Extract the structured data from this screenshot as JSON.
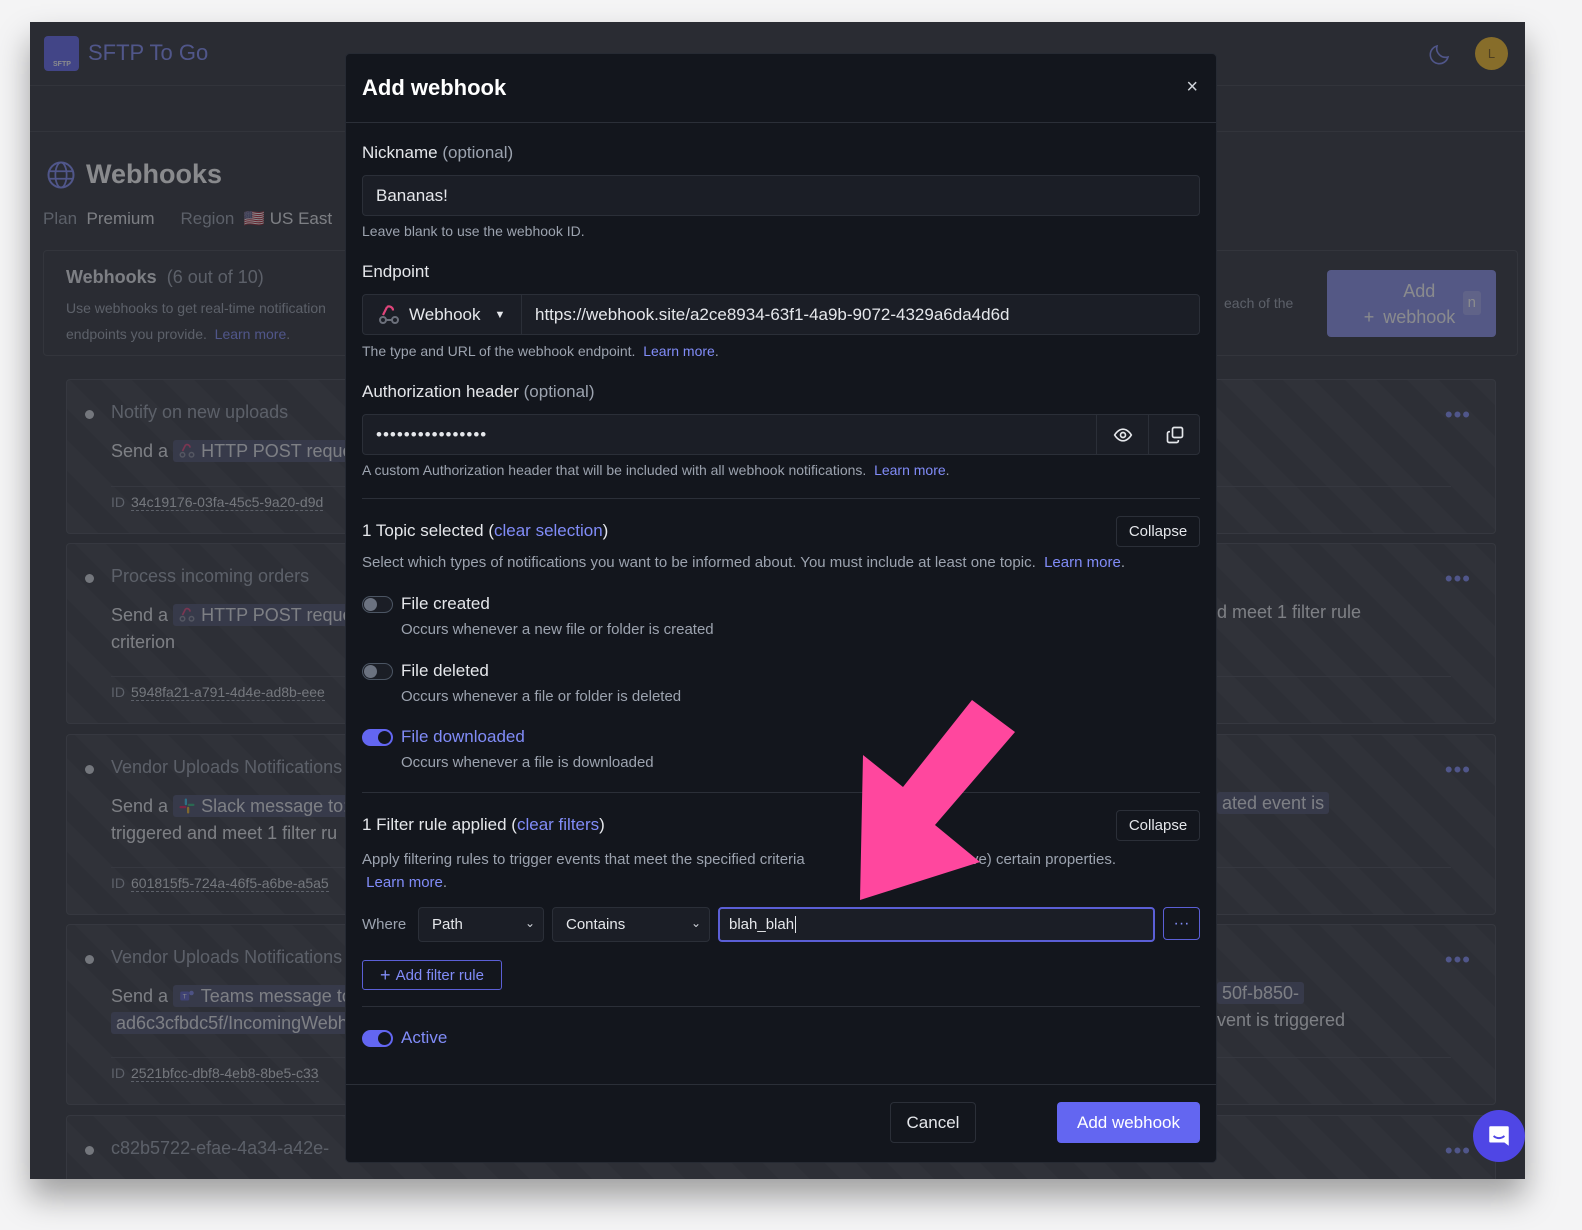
{
  "app": {
    "brand": "SFTP To Go",
    "logo_text": "SFTP",
    "avatar_initial": "L",
    "theme_icon": "moon-icon"
  },
  "page": {
    "title": "Webhooks",
    "plan_label": "Plan",
    "plan_value": "Premium",
    "region_label": "Region",
    "region_flag": "🇺🇸",
    "region_value": "US East",
    "panel": {
      "title": "Webhooks",
      "count": "(6 out of 10)",
      "description_start": "Use webhooks to get real-time notification",
      "description_end": "endpoints you provide.",
      "description_right": "each of the",
      "learn_more": "Learn more",
      "add_button": {
        "plus": "+",
        "label": "Add webhook",
        "shortcut": "n"
      }
    },
    "webhooks": [
      {
        "name": "Notify on new uploads",
        "send_prefix": "Send a",
        "chip": "HTTP POST reque",
        "chip_icon": "webhook-icon",
        "line2": "",
        "right_text": "",
        "id_label": "ID",
        "id": "34c19176-03fa-45c5-9a20-d9d"
      },
      {
        "name": "Process incoming orders",
        "send_prefix": "Send a",
        "chip": "HTTP POST reque",
        "chip_icon": "webhook-icon",
        "line2": "criterion",
        "right_text": "d meet 1 filter rule",
        "id_label": "ID",
        "id": "5948fa21-a791-4d4e-ad8b-eee"
      },
      {
        "name": "Vendor Uploads Notifications",
        "send_prefix": "Send a",
        "chip": "Slack message to:",
        "chip_icon": "slack-icon",
        "line2": "triggered and meet 1 filter ru",
        "right_text": "ated  event is",
        "id_label": "ID",
        "id": "601815f5-724a-46f5-a6be-a5a5"
      },
      {
        "name": "Vendor Uploads Notifications",
        "send_prefix": "Send a",
        "chip": "Teams message to",
        "chip_icon": "teams-icon",
        "line2": "ad6c3cfbdc5f/IncomingWebh",
        "right_text": "50f-b850-",
        "right_text2": "vent is triggered",
        "id_label": "ID",
        "id": "2521bfcc-dbf8-4eb8-8be5-c33"
      },
      {
        "name": "c82b5722-efae-4a34-a42e-",
        "send_prefix": "",
        "chip": "",
        "chip_icon": "",
        "line2": "",
        "right_text": "",
        "id_label": "",
        "id": ""
      }
    ]
  },
  "modal": {
    "title": "Add webhook",
    "close_label": "×",
    "nickname": {
      "label": "Nickname",
      "optional": "(optional)",
      "value": "Bananas!",
      "help": "Leave blank to use the webhook ID."
    },
    "endpoint": {
      "label": "Endpoint",
      "type_value": "Webhook",
      "url_value": "https://webhook.site/a2ce8934-63f1-4a9b-9072-4329a6da4d6d",
      "help": "The type and URL of the webhook endpoint.",
      "learn_more": "Learn more"
    },
    "auth": {
      "label": "Authorization header",
      "optional": "(optional)",
      "value": "••••••••••••••••",
      "help": "A custom Authorization header that will be included with all webhook notifications.",
      "learn_more": "Learn more"
    },
    "topics": {
      "heading": "1 Topic selected",
      "clear": "clear selection",
      "collapse": "Collapse",
      "description": "Select which types of notifications you want to be informed about. You must include at least one topic.",
      "learn_more": "Learn more",
      "items": [
        {
          "title": "File created",
          "desc": "Occurs whenever a new file or folder is created",
          "enabled": false
        },
        {
          "title": "File deleted",
          "desc": "Occurs whenever a file or folder is deleted",
          "enabled": false
        },
        {
          "title": "File downloaded",
          "desc": "Occurs whenever a file is downloaded",
          "enabled": true
        }
      ]
    },
    "filters": {
      "heading": "1 Filter rule applied",
      "clear": "clear filters",
      "collapse": "Collapse",
      "description_start": "Apply filtering rules to trigger events that meet the specified criteria",
      "description_end": "n't have) certain properties.",
      "learn_more": "Learn more",
      "where_label": "Where",
      "field_value": "Path",
      "operator_value": "Contains",
      "value": "blah_blah",
      "more": "···",
      "add_rule": "Add filter rule"
    },
    "active": {
      "label": "Active",
      "enabled": true
    },
    "cancel": "Cancel",
    "submit": "Add webhook"
  },
  "annotation": {
    "type": "arrow",
    "color": "#ff479e"
  }
}
